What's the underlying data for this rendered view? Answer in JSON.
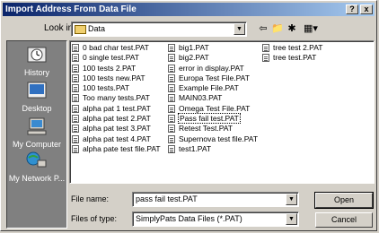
{
  "window": {
    "title": "Import Address From Data File",
    "help_label": "?",
    "close_label": "x"
  },
  "lookin": {
    "label": "Look in:",
    "value": "Data"
  },
  "places": [
    {
      "label": "History",
      "icon": "history-icon"
    },
    {
      "label": "Desktop",
      "icon": "desktop-icon"
    },
    {
      "label": "My Computer",
      "icon": "my-computer-icon"
    },
    {
      "label": "My Network P...",
      "icon": "network-icon"
    }
  ],
  "files": {
    "col1": [
      "0 bad char test.PAT",
      "0 single test.PAT",
      "100 tests 2.PAT",
      "100 tests new.PAT",
      "100 tests.PAT",
      "Too many tests.PAT",
      "alpha pat 1 test.PAT",
      "alpha pat test 2.PAT",
      "alpha pat test 3.PAT",
      "alpha pat test 4.PAT",
      "alpha pate test file.PAT"
    ],
    "col2": [
      "big1.PAT",
      "big2.PAT",
      "error in display.PAT",
      "Europa Test File.PAT",
      "Example File.PAT",
      "MAIN03.PAT",
      "Omega Test File.PAT",
      "Pass fail test.PAT",
      "Retest Test.PAT",
      "Supernova test file.PAT",
      "test1.PAT"
    ],
    "col3": [
      "tree test 2.PAT",
      "tree test.PAT"
    ]
  },
  "filename": {
    "label": "File name:",
    "value": "pass fail test.PAT"
  },
  "filetype": {
    "label": "Files of type:",
    "value": "SimplyPats Data Files (*.PAT)"
  },
  "buttons": {
    "open": "Open",
    "cancel": "Cancel"
  },
  "colors": {
    "title_start": "#0a246a",
    "title_end": "#a6caf0",
    "places_bg": "#808080"
  }
}
